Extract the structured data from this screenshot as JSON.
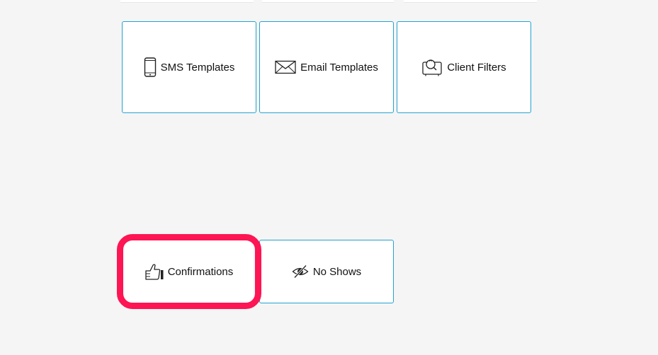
{
  "tiles": {
    "sms_templates": {
      "label": "SMS Templates",
      "icon": "smartphone-icon"
    },
    "email_templates": {
      "label": "Email Templates",
      "icon": "envelope-icon"
    },
    "client_filters": {
      "label": "Client Filters",
      "icon": "client-filter-icon"
    },
    "confirmations": {
      "label": "Confirmations",
      "icon": "thumbs-up-icon"
    },
    "no_shows": {
      "label": "No Shows",
      "icon": "eye-slash-icon"
    }
  },
  "colors": {
    "tile_border": "#23a3d0",
    "highlight": "#fd1554",
    "background": "#f5f5f5"
  }
}
